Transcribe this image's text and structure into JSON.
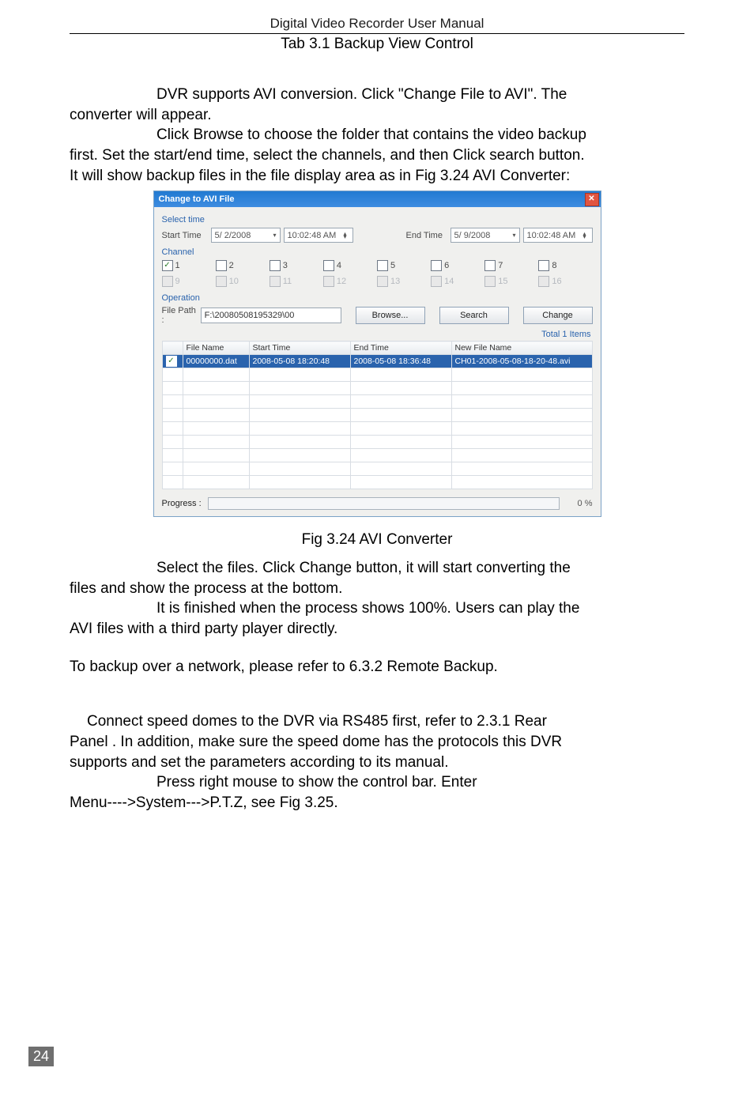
{
  "header": "Digital Video Recorder User Manual",
  "tab_caption": "Tab 3.1 Backup View Control",
  "para1_line1": "DVR supports AVI conversion. Click \"Change File to AVI\". The",
  "para1_line2": "converter will appear.",
  "para2_line1": "Click Browse to choose the folder that contains the video backup",
  "para2_line2": "first. Set the start/end time, select the channels, and then Click search button.",
  "para2_line3": "It will show backup files in the file display area as in Fig 3.24 AVI Converter:",
  "fig_caption": "Fig 3.24 AVI Converter",
  "para3_line1": "Select the files. Click Change button, it will start converting the",
  "para3_line2": "files and show the process at the bottom.",
  "para4_line1": "It is finished when the process shows 100%. Users can play the",
  "para4_line2": "AVI files with a third party player directly.",
  "para5": "To backup over a network, please refer to 6.3.2 Remote Backup.",
  "para6_line1": "Connect speed domes to the DVR via RS485 first, refer to 2.3.1 Rear",
  "para6_line2": "Panel . In addition, make sure the speed dome has the protocols this DVR",
  "para6_line3": "supports and set the parameters according to its manual.",
  "para7_line1": "Press right mouse to show the control bar. Enter",
  "para7_line2": "Menu---->System--->P.T.Z, see Fig 3.25.",
  "page_number": "24",
  "dialog": {
    "title": "Change to AVI File",
    "select_time": "Select time",
    "start_time_label": "Start Time",
    "start_date": "5/ 2/2008",
    "start_time": "10:02:48 AM",
    "end_time_label": "End Time",
    "end_date": "5/ 9/2008",
    "end_time": "10:02:48 AM",
    "channel_label": "Channel",
    "channels_row1": [
      "1",
      "2",
      "3",
      "4",
      "5",
      "6",
      "7",
      "8"
    ],
    "channels_row2": [
      "9",
      "10",
      "11",
      "12",
      "13",
      "14",
      "15",
      "16"
    ],
    "operation_label": "Operation",
    "file_path_label": "File Path :",
    "file_path_value": "F:\\20080508195329\\00",
    "browse_btn": "Browse...",
    "search_btn": "Search",
    "change_btn": "Change",
    "total_items": "Total 1 Items",
    "columns": [
      "",
      "File Name",
      "Start Time",
      "End Time",
      "New File Name"
    ],
    "row": {
      "file_name": "00000000.dat",
      "start_time": "2008-05-08 18:20:48",
      "end_time": "2008-05-08 18:36:48",
      "new_file_name": "CH01-2008-05-08-18-20-48.avi"
    },
    "progress_label": "Progress :",
    "progress_pct": "0 %"
  }
}
